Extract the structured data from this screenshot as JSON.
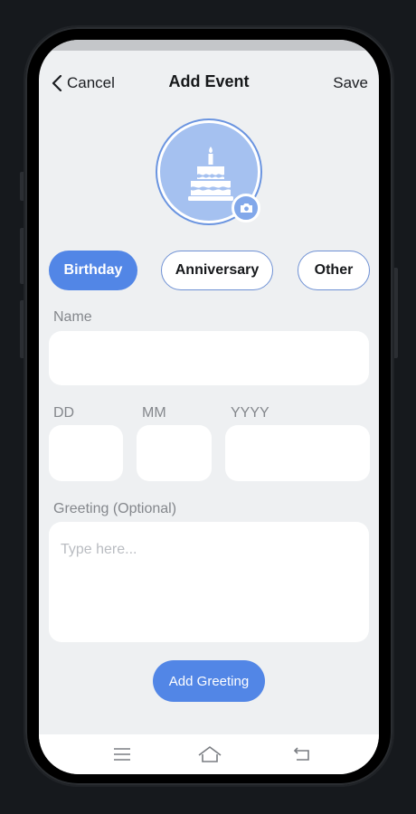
{
  "header": {
    "cancel_label": "Cancel",
    "title": "Add Event",
    "save_label": "Save"
  },
  "avatar": {
    "icon": "birthday-cake-icon",
    "badge_icon": "camera-icon",
    "fill_color": "#a5c1f0"
  },
  "event_types": [
    {
      "label": "Birthday",
      "selected": true
    },
    {
      "label": "Anniversary",
      "selected": false
    },
    {
      "label": "Other",
      "selected": false
    }
  ],
  "form": {
    "name_label": "Name",
    "name_value": "",
    "day_label": "DD",
    "month_label": "MM",
    "year_label": "YYYY",
    "greeting_label": "Greeting (Optional)",
    "greeting_placeholder": "Type here...",
    "greeting_value": ""
  },
  "add_greeting_label": "Add Greeting",
  "bottom_nav": {
    "icons": [
      "menu-icon",
      "home-icon",
      "back-icon"
    ]
  },
  "colors": {
    "accent": "#5286e6",
    "screen_bg": "#eef0f2",
    "field_bg": "#ffffff"
  }
}
